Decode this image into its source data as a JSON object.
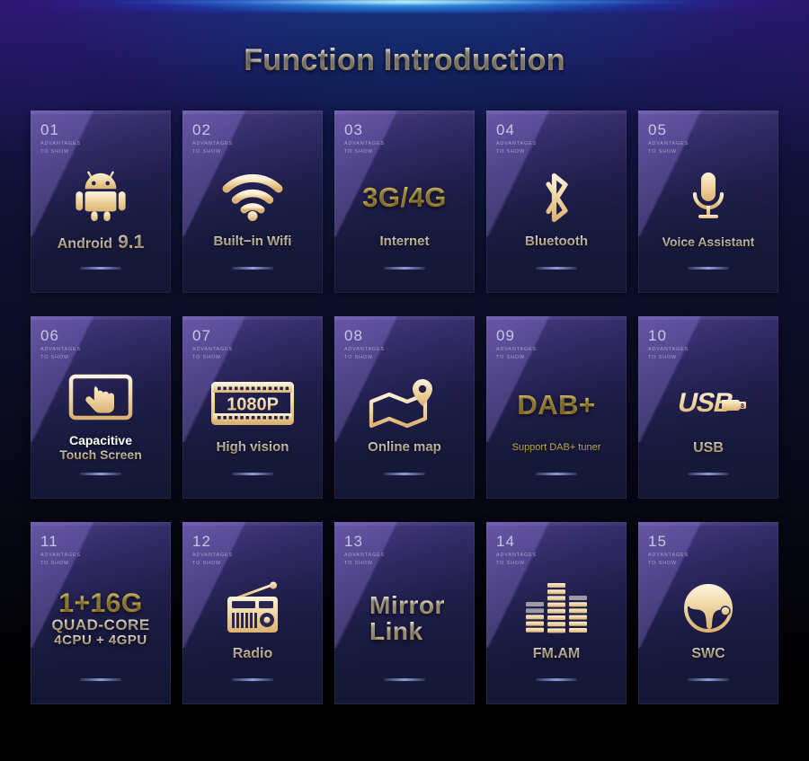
{
  "page": {
    "title": "Function Introduction",
    "background_colors": {
      "page": "#000000",
      "top_glow": "#8fe3ff",
      "panel_top": "#16123c",
      "panel_bottom": "#06060f"
    },
    "accent_colors": {
      "gold": "#e3c253",
      "cream": "#f7e4bf",
      "white": "#ffffff",
      "number": "#c8c6e4",
      "divider": "#8e9cd6"
    },
    "card_subtitle": {
      "line1": "ADVANTAGES",
      "line2": "TO SHOW"
    }
  },
  "cards": [
    {
      "number": "01",
      "icon": "android-robot-icon",
      "icon_kind": "svg",
      "labels": [
        {
          "text": "Android",
          "style": "cream",
          "size": "a1"
        },
        {
          "text": "9.1",
          "style": "cream",
          "size": "a2"
        }
      ]
    },
    {
      "number": "02",
      "icon": "wifi-icon",
      "icon_kind": "svg",
      "labels": [
        {
          "text": "Built−in Wifi",
          "style": "cream",
          "size": "s15"
        }
      ]
    },
    {
      "number": "03",
      "icon": "3g-4g-text-icon",
      "icon_kind": "text",
      "icon_text": "3G/4G",
      "icon_text_style": "gold",
      "labels": [
        {
          "text": "Internet",
          "style": "cream",
          "size": "s15"
        }
      ]
    },
    {
      "number": "04",
      "icon": "bluetooth-icon",
      "icon_kind": "svg",
      "labels": [
        {
          "text": "Bluetooth",
          "style": "cream",
          "size": "s15"
        }
      ]
    },
    {
      "number": "05",
      "icon": "microphone-icon",
      "icon_kind": "svg",
      "labels": [
        {
          "text": "Voice Assistant",
          "style": "cream",
          "size": "s14"
        }
      ]
    },
    {
      "number": "06",
      "icon": "touch-screen-icon",
      "icon_kind": "svg",
      "labels": [
        {
          "text": "Capacitive",
          "style": "white",
          "size": "s14"
        },
        {
          "text": "Touch Screen",
          "style": "cream",
          "size": "s14"
        }
      ]
    },
    {
      "number": "07",
      "icon": "film-strip-1080p-icon",
      "icon_kind": "svg",
      "icon_text": "1080P",
      "labels": [
        {
          "text": "High vision",
          "style": "cream",
          "size": "s15"
        }
      ]
    },
    {
      "number": "08",
      "icon": "map-pin-icon",
      "icon_kind": "svg",
      "labels": [
        {
          "text": "Online map",
          "style": "cream",
          "size": "s15"
        }
      ]
    },
    {
      "number": "09",
      "icon": "dab-plus-text-icon",
      "icon_kind": "text",
      "icon_text": "DAB+",
      "icon_text_style": "gold",
      "labels": [
        {
          "text": "Support DAB+ tuner",
          "style": "gold",
          "size": "s11"
        }
      ]
    },
    {
      "number": "10",
      "icon": "usb-logo-icon",
      "icon_kind": "svg",
      "icon_text": "USB",
      "labels": [
        {
          "text": "USB",
          "style": "cream",
          "size": "s16"
        }
      ]
    },
    {
      "number": "11",
      "icon": "memory-spec-text-icon",
      "icon_kind": "stack",
      "stack": [
        {
          "text": "1+16G",
          "style": "gold",
          "size": "l1"
        },
        {
          "text": "QUAD-CORE",
          "style": "cream",
          "size": "l2"
        },
        {
          "text": "4CPU + 4GPU",
          "style": "cream",
          "size": "l3"
        }
      ]
    },
    {
      "number": "12",
      "icon": "radio-icon",
      "icon_kind": "svg",
      "labels": [
        {
          "text": "Radio",
          "style": "cream",
          "size": "s16"
        }
      ]
    },
    {
      "number": "13",
      "icon": "mirror-link-text-icon",
      "icon_kind": "stack2",
      "stack": [
        {
          "text": "Mirror",
          "style": "cream",
          "size": "l1"
        },
        {
          "text": "Link",
          "style": "cream",
          "size": "l2"
        }
      ]
    },
    {
      "number": "14",
      "icon": "equalizer-icon",
      "icon_kind": "svg",
      "labels": [
        {
          "text": "FM.AM",
          "style": "cream",
          "size": "s16"
        }
      ]
    },
    {
      "number": "15",
      "icon": "steering-wheel-icon",
      "icon_kind": "svg",
      "labels": [
        {
          "text": "SWC",
          "style": "cream",
          "size": "s16"
        }
      ]
    }
  ]
}
